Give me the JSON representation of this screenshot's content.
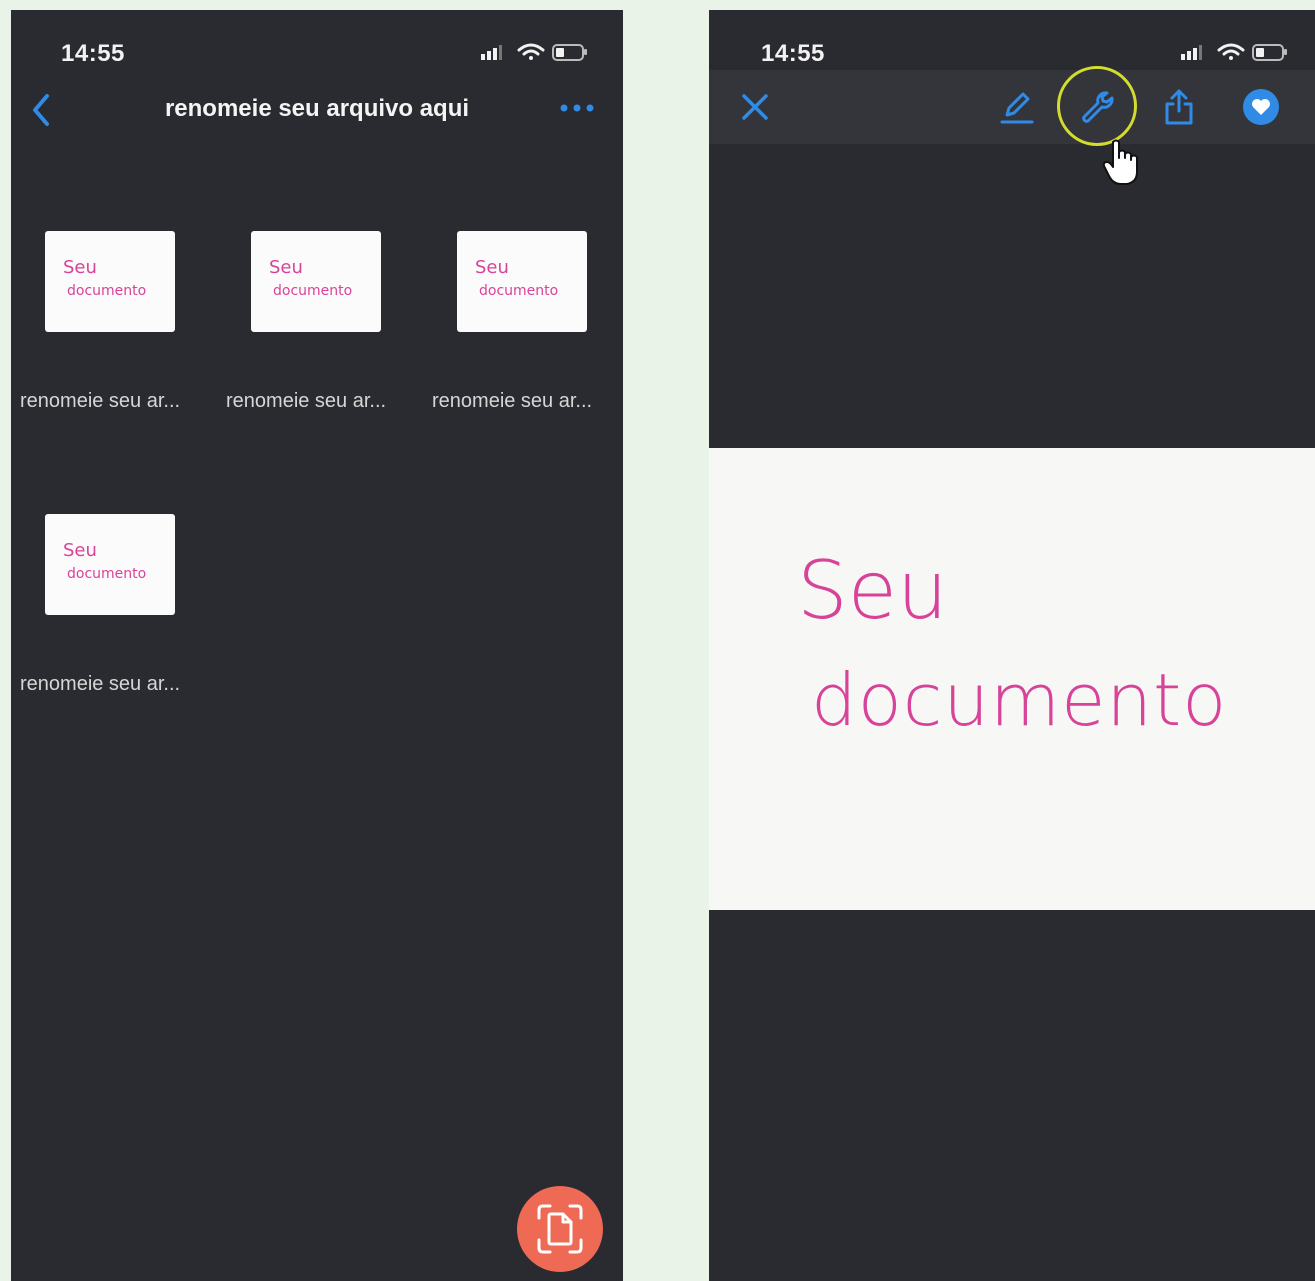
{
  "left_screen": {
    "status_time": "14:55",
    "header": {
      "title": "renomeie seu arquivo aqui",
      "back_icon": "chevron-left-icon",
      "more_icon": "ellipsis-icon"
    },
    "files": [
      {
        "name": "renomeie seu ar...",
        "thumb_line1": "Seu",
        "thumb_line2": "documento"
      },
      {
        "name": "renomeie seu ar...",
        "thumb_line1": "Seu",
        "thumb_line2": "documento"
      },
      {
        "name": "renomeie seu ar...",
        "thumb_line1": "Seu",
        "thumb_line2": "documento"
      },
      {
        "name": "renomeie seu ar...",
        "thumb_line1": "Seu",
        "thumb_line2": "documento"
      }
    ],
    "scan_button_icon": "document-scan-icon"
  },
  "right_screen": {
    "status_time": "14:55",
    "toolbar_icons": [
      "close-icon",
      "pencil-icon",
      "wrench-icon",
      "share-icon",
      "heart-icon"
    ],
    "document_text": {
      "line1": "Seu",
      "line2": "documento"
    }
  },
  "colors": {
    "screen_bg": "#2a2a31",
    "page_bg": "#eaf3e8",
    "accent_blue": "#2f8be6",
    "scan_button": "#ef6a55",
    "highlight_ring": "#d4dc2e",
    "handwriting": "#d8439a"
  }
}
